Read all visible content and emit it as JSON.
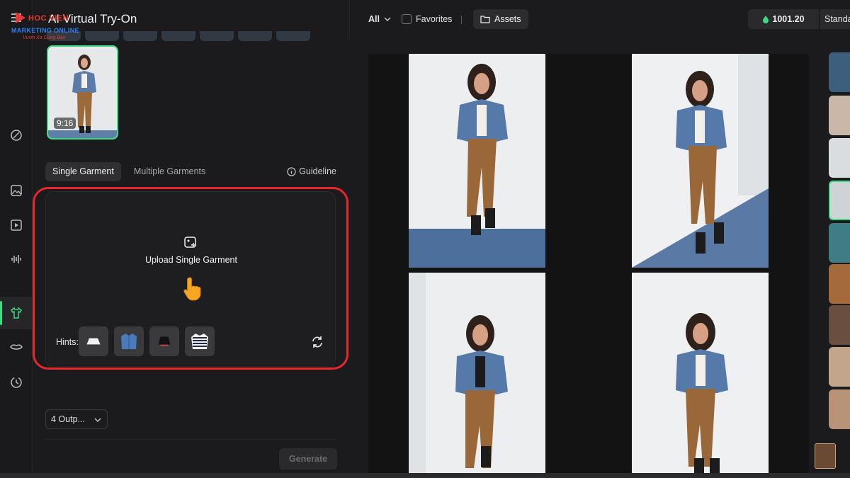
{
  "logo": {
    "brand": "HOC VIEN",
    "sub": "MARKETING ONLINE",
    "tag": "Vươn Xa Cùng Bạn"
  },
  "panel": {
    "title": "AI Virtual Try-On",
    "model_ratio": "9:16",
    "tabs": [
      {
        "label": "Single Garment",
        "active": true
      },
      {
        "label": "Multiple Garments",
        "active": false
      }
    ],
    "guideline_label": "Guideline",
    "upload_label": "Upload Single Garment",
    "hints_label": "Hints:",
    "hints": [
      "white-skirt-icon",
      "denim-jacket-icon",
      "black-skirt-icon",
      "striped-sweater-icon"
    ],
    "outputs_value": "4 Outp...",
    "generate_label": "Generate"
  },
  "topbar": {
    "filter_label": "All",
    "favorites_label": "Favorites",
    "assets_label": "Assets",
    "credits": "1001.20",
    "plan_label": "Standa"
  },
  "gallery": {
    "photos": [
      {
        "name": "result-photo-1"
      },
      {
        "name": "result-photo-2"
      },
      {
        "name": "result-photo-3"
      },
      {
        "name": "result-photo-4"
      }
    ]
  },
  "colors": {
    "accent": "#3ddc84",
    "highlight": "#e8262c",
    "background": "#1b1b1d"
  }
}
